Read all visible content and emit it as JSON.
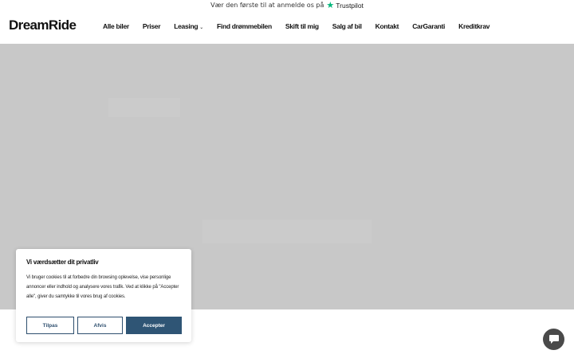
{
  "topbar": {
    "review_text": "Vær den første til at anmelde os på",
    "trustpilot": "Trustpilot"
  },
  "header": {
    "logo": "DreamRide",
    "nav": [
      {
        "label": "Alle biler"
      },
      {
        "label": "Priser"
      },
      {
        "label": "Leasing"
      },
      {
        "label": "Find drømmebilen"
      },
      {
        "label": "Skift til mig"
      },
      {
        "label": "Salg af bil"
      },
      {
        "label": "Kontakt"
      },
      {
        "label": "CarGaranti"
      },
      {
        "label": "Kreditkrav"
      }
    ]
  },
  "cookie": {
    "title": "Vi værdsætter dit privatliv",
    "text": "Vi bruger cookies til at forbedre din browsing oplevelse, vise personlige annoncer eller indhold og analysere vores trafik. Ved at klikke på \"Accepter alle\", giver du samtykke til vores brug af cookies.",
    "customize": "Tilpas",
    "reject": "Afvis",
    "accept": "Accepter"
  },
  "colors": {
    "trustpilot_green": "#00b67a",
    "hero_bg": "#c8c8c8",
    "button_primary": "#2f5575",
    "chat_bg": "#4a4a4a"
  },
  "icons": {
    "trustpilot": "star-icon",
    "leasing_dropdown": "chevron-down-icon",
    "chat": "chat-bubble-icon"
  }
}
